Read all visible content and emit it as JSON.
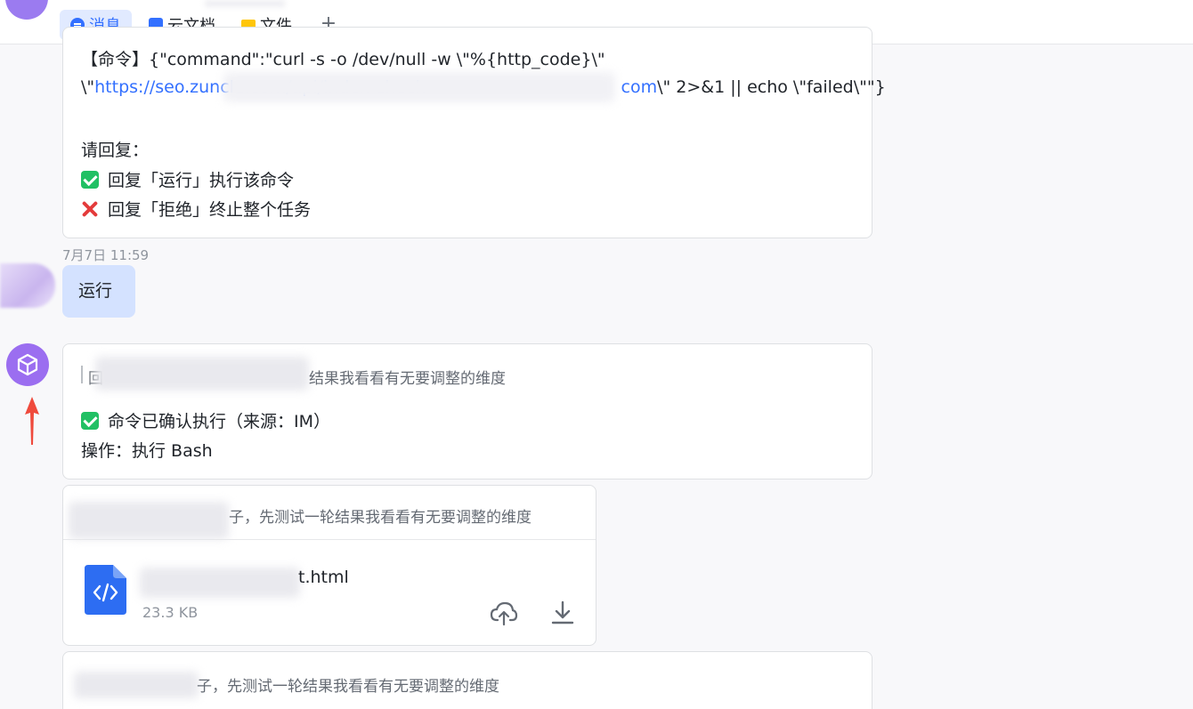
{
  "tabs": [
    {
      "label": "消息",
      "icon": "message-icon",
      "active": true
    },
    {
      "label": "云文档",
      "icon": "cloud-doc-icon",
      "active": false
    },
    {
      "label": "文件",
      "icon": "folder-icon",
      "active": false
    }
  ],
  "add_tab_label": "+",
  "msg1": {
    "command_prefix": "【命令】",
    "line1": "{\"command\":\"curl -s -o /dev/null -w \\\"%{http_code}\\\"",
    "line2_start": "\\\"",
    "line2_link": "https://seo.zuncle.com/api/index-check",
    "line2_link_end": "com",
    "line2_end": "\\\" 2>&1 || echo \\\"failed\\\"\"}",
    "reply_prompt": "请回复：",
    "option_run": "回复「运行」执行该命令",
    "option_reject": "回复「拒绝」终止整个任务"
  },
  "timestamp": "7月7日 11:59",
  "user_reply": "运行",
  "msg2": {
    "quote_start": "回",
    "quote_text": "结果我看看有无要调整的维度",
    "confirmed": "命令已确认执行（来源：IM）",
    "operation": "操作：执行 Bash"
  },
  "msg3": {
    "quote_text": "子，先测试一轮结果我看看有无要调整的维度",
    "file_name_tail": "t.html",
    "file_size": "23.3 KB"
  },
  "msg4": {
    "quote_text": "子，先测试一轮结果我看看有无要调整的维度"
  },
  "colors": {
    "accent": "#3370ff",
    "user_bubble": "#d4e2ff",
    "check_green": "#21c064",
    "cross_red": "#e43b3b",
    "bot_avatar": "#9b6ef0"
  }
}
